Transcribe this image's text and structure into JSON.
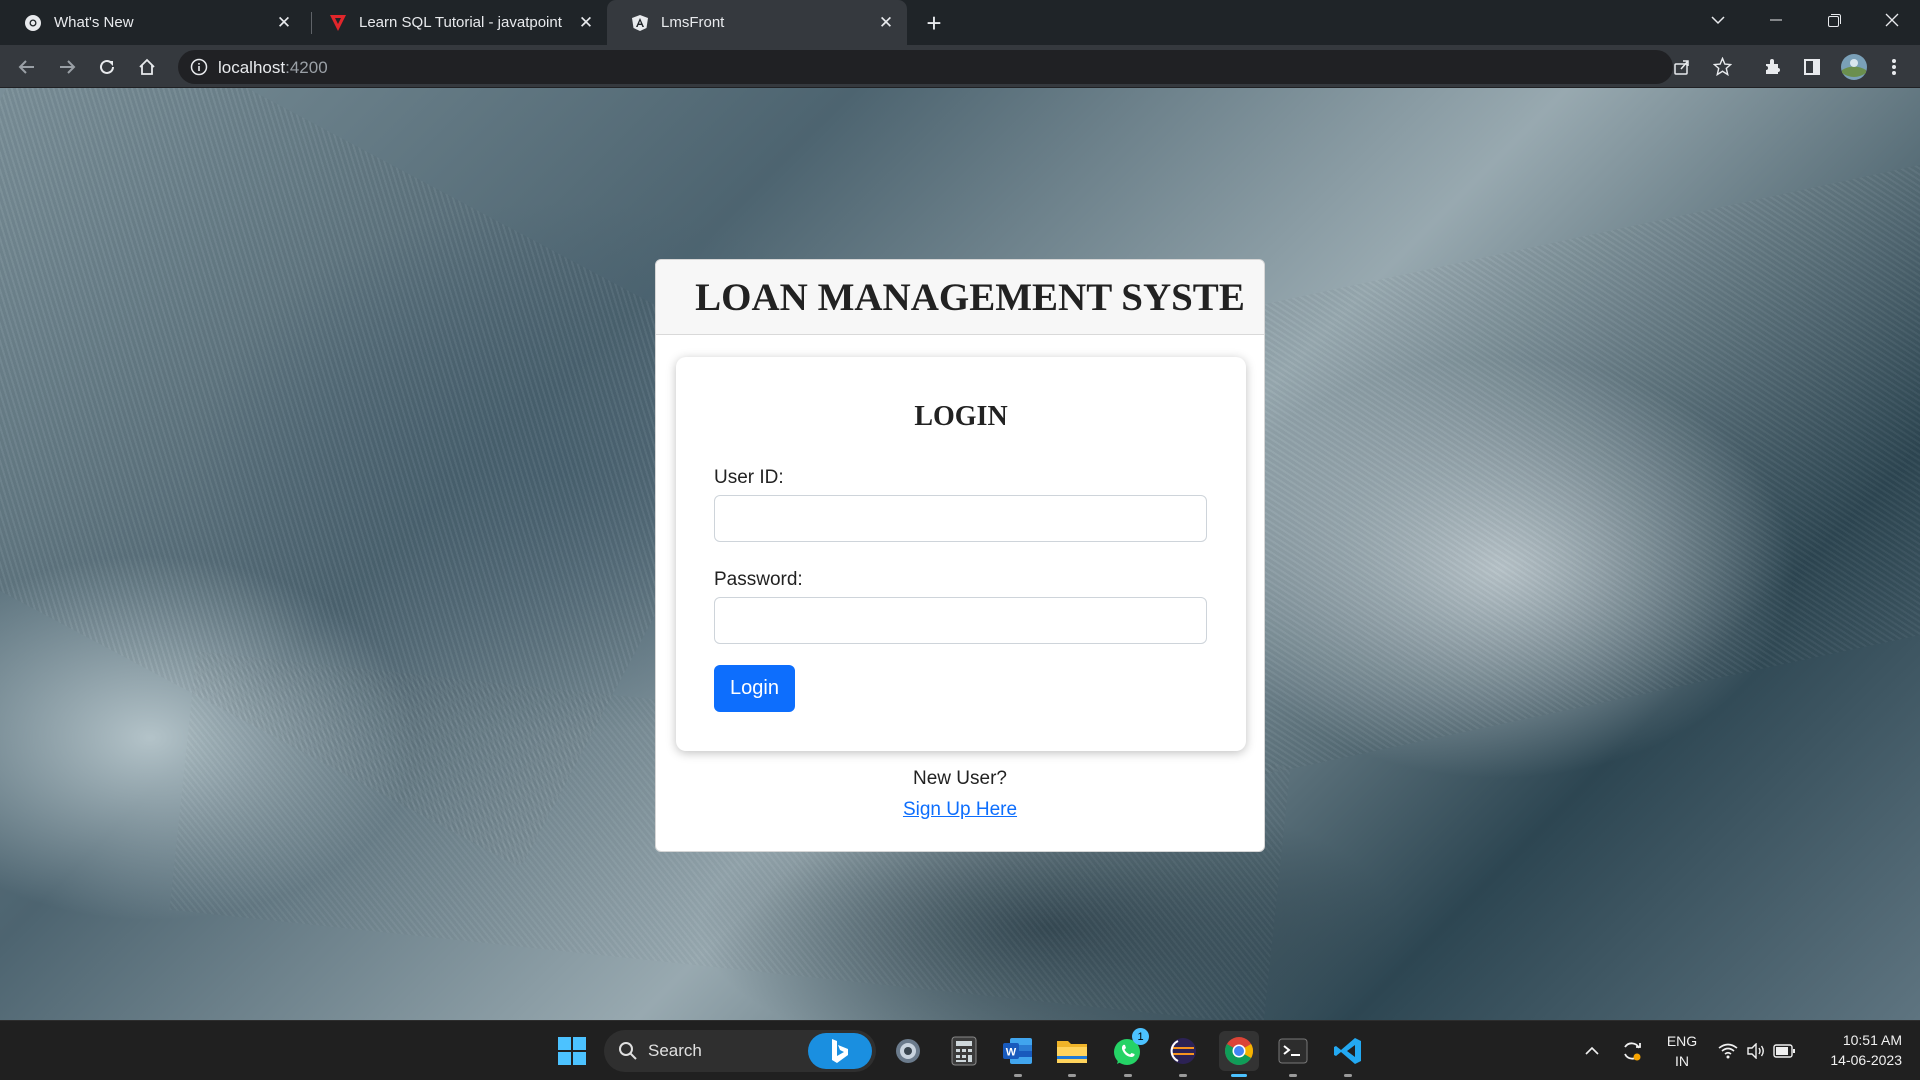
{
  "browser": {
    "tabs": [
      {
        "title": "What's New",
        "icon": "chrome-icon"
      },
      {
        "title": "Learn SQL Tutorial - javatpoint",
        "icon": "javatpoint-icon"
      },
      {
        "title": "LmsFront",
        "icon": "angular-icon",
        "active": true
      }
    ],
    "url_host": "localhost",
    "url_port": ":4200"
  },
  "page": {
    "app_title": "LOAN MANAGEMENT SYSTE",
    "login_heading": "LOGIN",
    "userid_label": "User ID:",
    "userid_value": "",
    "password_label": "Password:",
    "password_value": "",
    "login_button": "Login",
    "new_user_text": "New User?",
    "signup_link": "Sign Up Here",
    "primary_color": "#0d6efd"
  },
  "taskbar": {
    "search_label": "Search",
    "whatsapp_badge": "1",
    "lang_top": "ENG",
    "lang_bottom": "IN",
    "time": "10:51 AM",
    "date": "14-06-2023"
  }
}
